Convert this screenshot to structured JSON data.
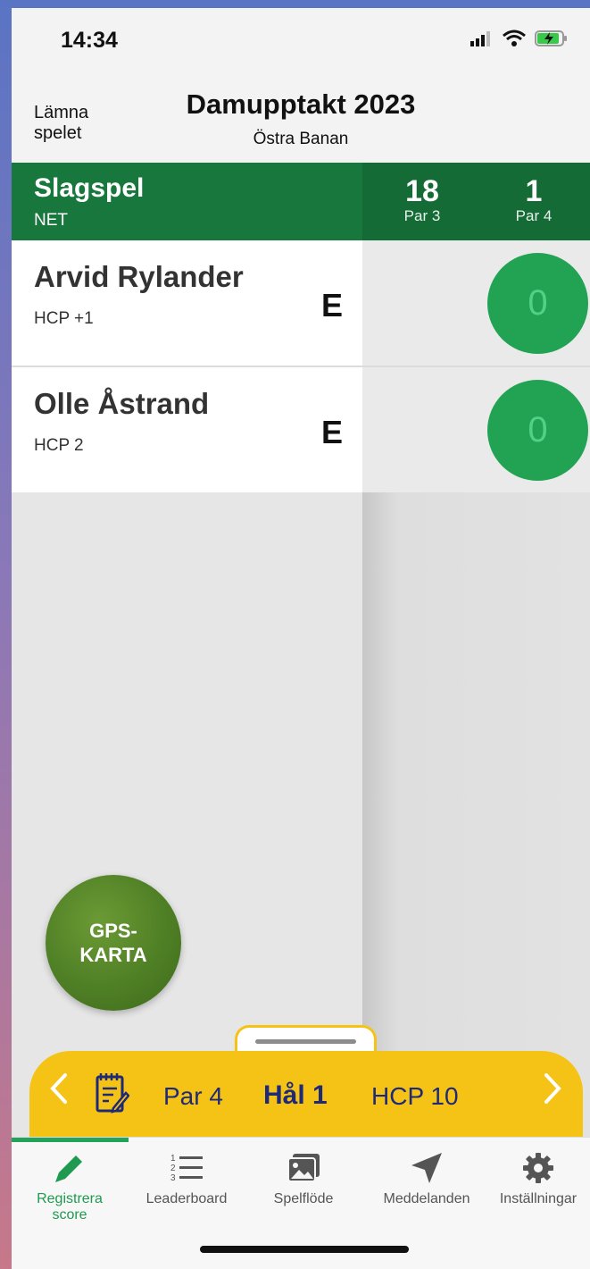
{
  "status_bar": {
    "time": "14:34"
  },
  "header": {
    "leave_label": "Lämna\nspelet",
    "leave_line1": "Lämna",
    "leave_line2": "spelet",
    "title": "Damupptakt 2023",
    "course": "Östra Banan"
  },
  "scoreboard": {
    "mode": "Slagspel",
    "scoring": "NET",
    "holes": [
      {
        "number": "18",
        "par": "Par 3"
      },
      {
        "number": "1",
        "par": "Par 4"
      }
    ]
  },
  "players": [
    {
      "name": "Arvid Rylander",
      "hcp": "HCP +1",
      "total": "E",
      "hole_score": "0"
    },
    {
      "name": "Olle Åstrand",
      "hcp": "HCP 2",
      "total": "E",
      "hole_score": "0"
    }
  ],
  "gps_button": {
    "line1": "GPS-",
    "line2": "KARTA"
  },
  "hole_bar": {
    "par": "Par 4",
    "hole": "Hål 1",
    "hcp": "HCP 10"
  },
  "tabs": [
    {
      "label_line1": "Registrera",
      "label_line2": "score",
      "icon": "pencil-icon",
      "active": true
    },
    {
      "label_line1": "Leaderboard",
      "label_line2": "",
      "icon": "numbered-list-icon",
      "active": false
    },
    {
      "label_line1": "Spelflöde",
      "label_line2": "",
      "icon": "image-icon",
      "active": false
    },
    {
      "label_line1": "Meddelanden",
      "label_line2": "",
      "icon": "send-icon",
      "active": false
    },
    {
      "label_line1": "Inställningar",
      "label_line2": "",
      "icon": "gear-icon",
      "active": false
    }
  ],
  "colors": {
    "green": "#18773c",
    "score_green": "#22a353",
    "yellow": "#f5c316",
    "navy_text": "#1e2a78"
  }
}
